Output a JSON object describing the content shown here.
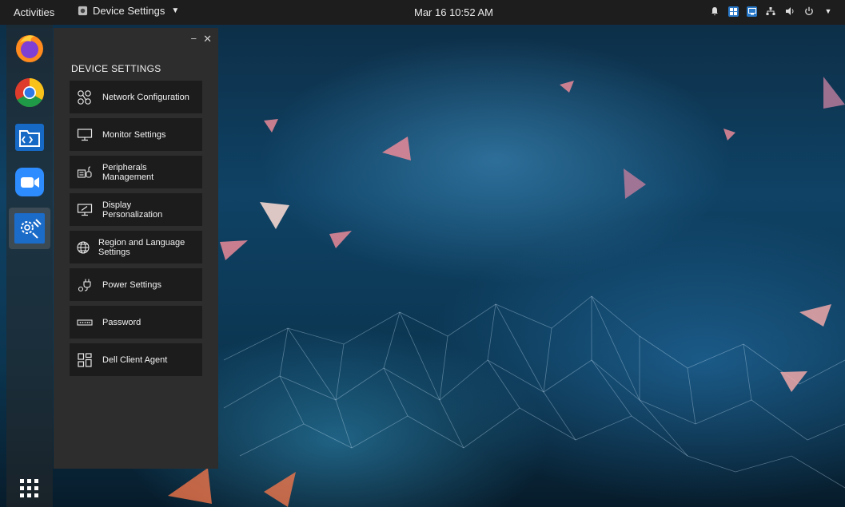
{
  "topbar": {
    "activities": "Activities",
    "app_name": "Device Settings",
    "clock": "Mar 16  10:52 AM"
  },
  "dock": {
    "apps": [
      "firefox-icon",
      "chrome-icon",
      "file-manager-icon",
      "zoom-icon",
      "device-settings-icon"
    ],
    "show_apps": "app-grid-icon"
  },
  "panel": {
    "title": "DEVICE SETTINGS",
    "minimize": "−",
    "close": "✕",
    "items": [
      {
        "label": "Network Configuration",
        "icon": "network-icon"
      },
      {
        "label": "Monitor Settings",
        "icon": "monitor-icon"
      },
      {
        "label": "Peripherals Management",
        "icon": "peripherals-icon"
      },
      {
        "label": "Display Personalization",
        "icon": "display-icon"
      },
      {
        "label": "Region and Language Settings",
        "icon": "globe-icon"
      },
      {
        "label": "Power Settings",
        "icon": "power-plug-icon"
      },
      {
        "label": "Password",
        "icon": "password-icon"
      },
      {
        "label": "Dell Client Agent",
        "icon": "grid-icon"
      }
    ]
  },
  "colors": {
    "topbar": "#1d1d1d",
    "panel": "#2d2d2d",
    "menu_item": "#1c1c1c",
    "accent_blue": "#2a79c9"
  }
}
